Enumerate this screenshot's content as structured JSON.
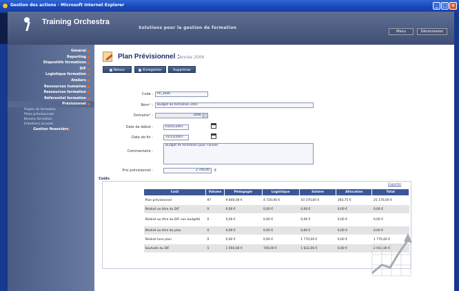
{
  "window": {
    "title": "Gestion des actions - Microsoft Internet Explorer"
  },
  "header": {
    "brand": "Training Orchestra",
    "tagline": "Solutions pour la gestion de formation",
    "buttons": [
      "Menu",
      "Déconnexion"
    ]
  },
  "sidebar": {
    "items": [
      {
        "label": "Général"
      },
      {
        "label": "Reporting"
      },
      {
        "label": "Dispositifs formations"
      },
      {
        "label": "DIF"
      },
      {
        "label": "Logistique formation"
      },
      {
        "label": "Ateliers"
      },
      {
        "label": "Ressources humaines"
      },
      {
        "label": "Ressources formation"
      },
      {
        "label": "Référentiel formation"
      },
      {
        "label": "Prévisionnel"
      }
    ],
    "subitems": [
      "Projets de formation",
      "Plans prévisionnels",
      "Besoins formation",
      "Entretiens annuels"
    ],
    "footer_item": "Gestion financière"
  },
  "page": {
    "title": "Plan Prévisionnel :",
    "subtitle": "Année 2006",
    "actions": [
      "Retour",
      "Enregistrer",
      "Supprimer"
    ]
  },
  "form": {
    "code_label": "Code",
    "code_value": "PP_2006",
    "name_label": "Nom",
    "name_value": "Budget de formation 2007",
    "domain_label": "Domaine",
    "domain_value": "2006",
    "start_label": "Date de début",
    "start_value": "01/01/2007",
    "end_label": "Date de fin",
    "end_value": "31/12/2007",
    "comment_label": "Commentaire",
    "comment_value": "Budget de formation pour l'année",
    "budget_label": "Prix prévisionnel",
    "budget_value": "2 700,00",
    "budget_unit": "€"
  },
  "costs": {
    "section_title": "Coûts",
    "export_label": "Exporter",
    "columns": [
      "Coût",
      "Volume",
      "Pédagogie",
      "Logistique",
      "Salaire",
      "Allocation",
      "Total"
    ],
    "rows": [
      [
        "Plan prévisionnel",
        "97",
        "9 840,00 €",
        "4 720,00 €",
        "10 370,00 €",
        "393,75 €",
        "25 170,00 €"
      ],
      [
        "Réalisé au titre du DIF",
        "0",
        "0,00 €",
        "0,00 €",
        "0,00 €",
        "0,00 €",
        "0,00 €"
      ],
      [
        "Réalisé au titre du DIF non budgété",
        "0",
        "0,00 €",
        "0,00 €",
        "0,00 €",
        "0,00 €",
        "0,00 €"
      ],
      [
        "Réalisé au titre du plan",
        "0",
        "0,00 €",
        "0,00 €",
        "0,00 €",
        "0,00 €",
        "0,00 €"
      ],
      [
        "Réalisé hors plan",
        "0",
        "0,00 €",
        "0,00 €",
        "1 770,00 €",
        "0,00 €",
        "1 770,00 €"
      ],
      [
        "Souhaits du DIF",
        "5",
        "1 050,00 €",
        "700,00 €",
        "1 022,00 €",
        "0,00 €",
        "2 910,00 €"
      ]
    ]
  },
  "colors": {
    "header": "#4f5f85",
    "sidebar": "#5a6c94",
    "table_header": "#3b5797",
    "accent": "#e06a2c"
  },
  "icons": {
    "page_icon": "edit-document-icon",
    "calendar_icon": "calendar-icon",
    "logo": "training-orchestra-logo"
  }
}
